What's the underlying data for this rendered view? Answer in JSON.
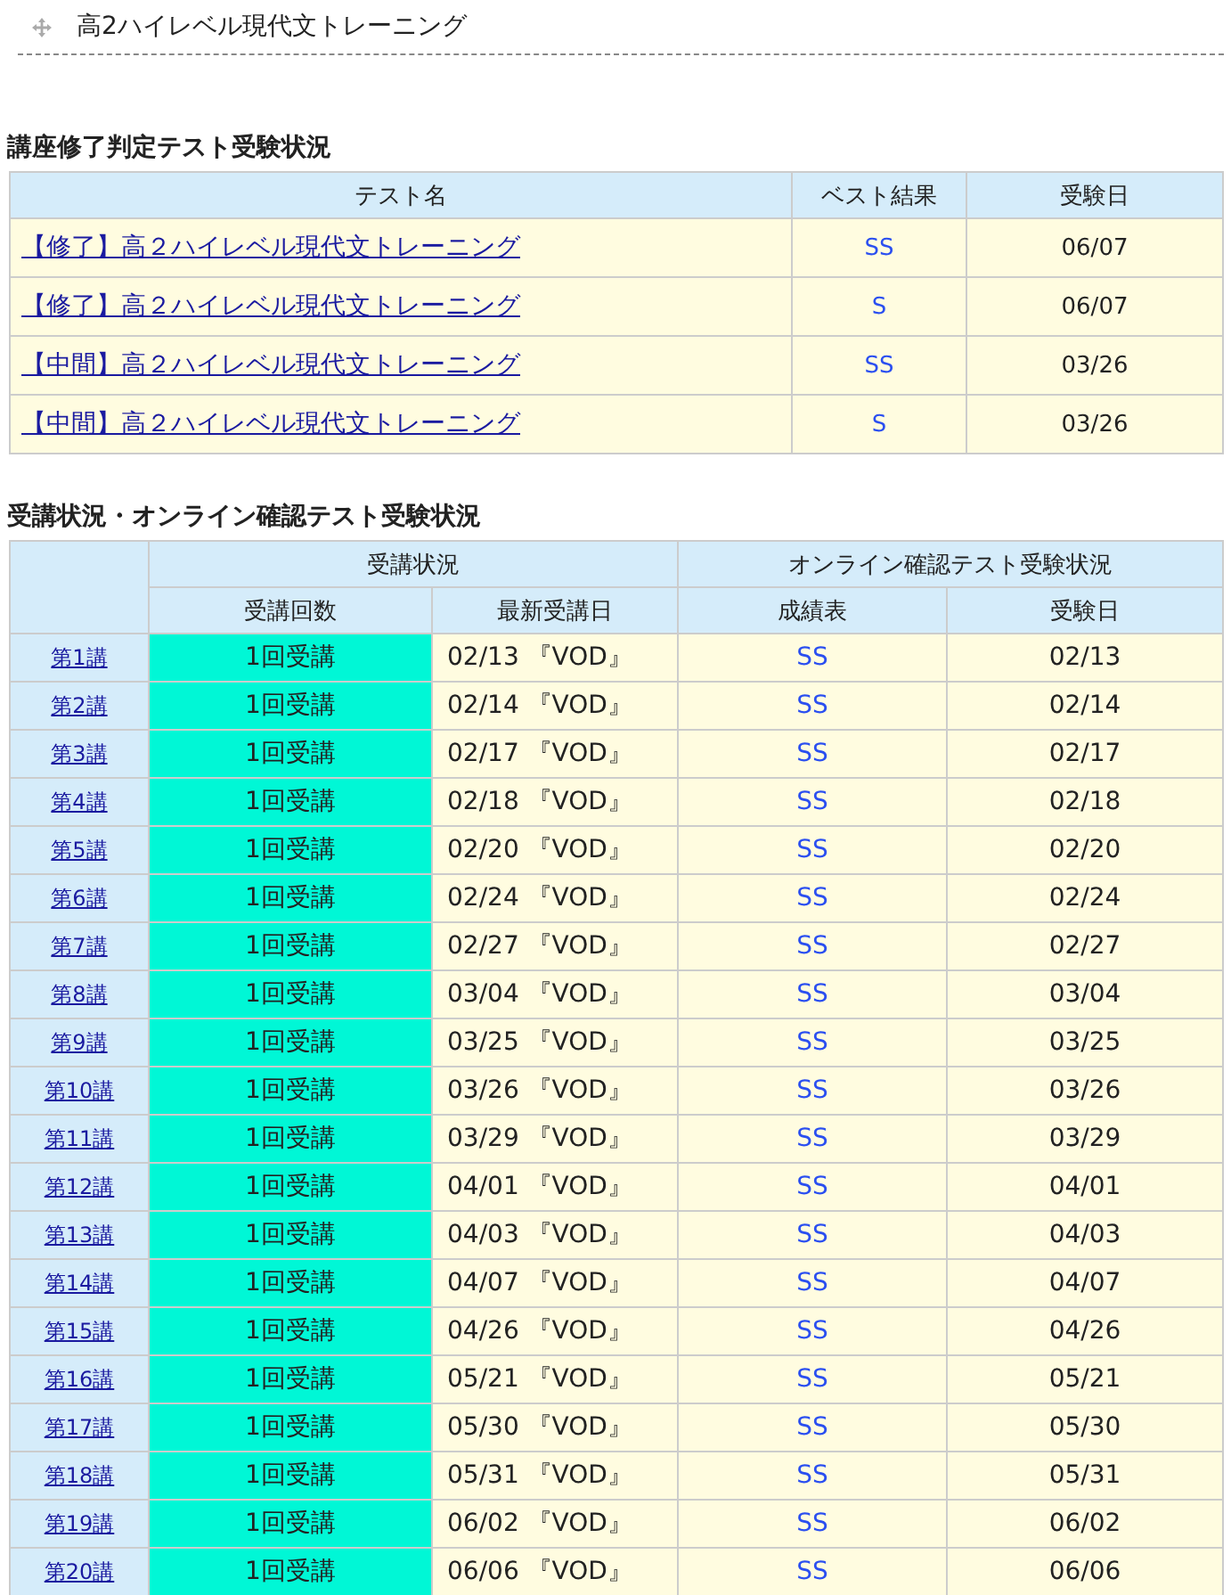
{
  "page_title": "高2ハイレベル現代文トレーニング",
  "completion_tests": {
    "title": "講座修了判定テスト受験状況",
    "columns": [
      "テスト名",
      "ベスト結果",
      "受験日"
    ],
    "rows": [
      {
        "name": "【修了】高２ハイレベル現代文トレーニング",
        "best": "SS",
        "date": "06/07"
      },
      {
        "name": "【修了】高２ハイレベル現代文トレーニング",
        "best": "S",
        "date": "06/07"
      },
      {
        "name": "【中間】高２ハイレベル現代文トレーニング",
        "best": "SS",
        "date": "03/26"
      },
      {
        "name": "【中間】高２ハイレベル現代文トレーニング",
        "best": "S",
        "date": "03/26"
      }
    ]
  },
  "attendance": {
    "title": "受講状況・オンライン確認テスト受験状況",
    "group_headers": [
      "受講状況",
      "オンライン確認テスト受験状況"
    ],
    "columns": [
      "受講回数",
      "最新受講日",
      "成績表",
      "受験日"
    ],
    "rows": [
      {
        "lecture": "第1講",
        "count": "1回受講",
        "latest": "02/13 『VOD』",
        "grade": "SS",
        "test_date": "02/13"
      },
      {
        "lecture": "第2講",
        "count": "1回受講",
        "latest": "02/14 『VOD』",
        "grade": "SS",
        "test_date": "02/14"
      },
      {
        "lecture": "第3講",
        "count": "1回受講",
        "latest": "02/17 『VOD』",
        "grade": "SS",
        "test_date": "02/17"
      },
      {
        "lecture": "第4講",
        "count": "1回受講",
        "latest": "02/18 『VOD』",
        "grade": "SS",
        "test_date": "02/18"
      },
      {
        "lecture": "第5講",
        "count": "1回受講",
        "latest": "02/20 『VOD』",
        "grade": "SS",
        "test_date": "02/20"
      },
      {
        "lecture": "第6講",
        "count": "1回受講",
        "latest": "02/24 『VOD』",
        "grade": "SS",
        "test_date": "02/24"
      },
      {
        "lecture": "第7講",
        "count": "1回受講",
        "latest": "02/27 『VOD』",
        "grade": "SS",
        "test_date": "02/27"
      },
      {
        "lecture": "第8講",
        "count": "1回受講",
        "latest": "03/04 『VOD』",
        "grade": "SS",
        "test_date": "03/04"
      },
      {
        "lecture": "第9講",
        "count": "1回受講",
        "latest": "03/25 『VOD』",
        "grade": "SS",
        "test_date": "03/25"
      },
      {
        "lecture": "第10講",
        "count": "1回受講",
        "latest": "03/26 『VOD』",
        "grade": "SS",
        "test_date": "03/26"
      },
      {
        "lecture": "第11講",
        "count": "1回受講",
        "latest": "03/29 『VOD』",
        "grade": "SS",
        "test_date": "03/29"
      },
      {
        "lecture": "第12講",
        "count": "1回受講",
        "latest": "04/01 『VOD』",
        "grade": "SS",
        "test_date": "04/01"
      },
      {
        "lecture": "第13講",
        "count": "1回受講",
        "latest": "04/03 『VOD』",
        "grade": "SS",
        "test_date": "04/03"
      },
      {
        "lecture": "第14講",
        "count": "1回受講",
        "latest": "04/07 『VOD』",
        "grade": "SS",
        "test_date": "04/07"
      },
      {
        "lecture": "第15講",
        "count": "1回受講",
        "latest": "04/26 『VOD』",
        "grade": "SS",
        "test_date": "04/26"
      },
      {
        "lecture": "第16講",
        "count": "1回受講",
        "latest": "05/21 『VOD』",
        "grade": "SS",
        "test_date": "05/21"
      },
      {
        "lecture": "第17講",
        "count": "1回受講",
        "latest": "05/30 『VOD』",
        "grade": "SS",
        "test_date": "05/30"
      },
      {
        "lecture": "第18講",
        "count": "1回受講",
        "latest": "05/31 『VOD』",
        "grade": "SS",
        "test_date": "05/31"
      },
      {
        "lecture": "第19講",
        "count": "1回受講",
        "latest": "06/02 『VOD』",
        "grade": "SS",
        "test_date": "06/02"
      },
      {
        "lecture": "第20講",
        "count": "1回受講",
        "latest": "06/06 『VOD』",
        "grade": "SS",
        "test_date": "06/06"
      }
    ]
  }
}
